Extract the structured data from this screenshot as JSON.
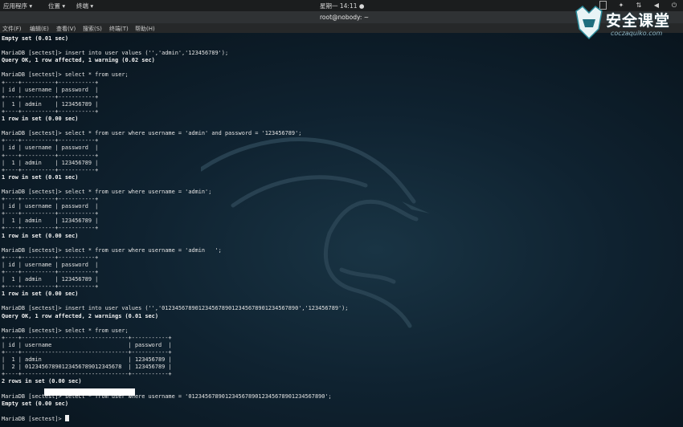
{
  "system_bar": {
    "menus": [
      "应用程序 ▾",
      "位置 ▾",
      "终端 ▾"
    ],
    "clock": "星期一 14:11 ●"
  },
  "window": {
    "title": "root@nobody: ~"
  },
  "terminal_menu": [
    "文件(F)",
    "编辑(E)",
    "查看(V)",
    "搜索(S)",
    "终端(T)",
    "帮助(H)"
  ],
  "watermark": {
    "text": "安全课堂",
    "sub": "coczaquiko.com"
  },
  "terminal_lines": [
    {
      "text": "Empty set (0.01 sec)",
      "bold": true
    },
    {
      "text": "",
      "bold": false
    },
    {
      "text": "MariaDB [sectest]> insert into user values ('','admin','123456789');",
      "bold": false
    },
    {
      "text": "Query OK, 1 row affected, 1 warning (0.02 sec)",
      "bold": true
    },
    {
      "text": "",
      "bold": false
    },
    {
      "text": "MariaDB [sectest]> select * from user;",
      "bold": false
    },
    {
      "text": "+----+----------+-----------+",
      "bold": false
    },
    {
      "text": "| id | username | password  |",
      "bold": false
    },
    {
      "text": "+----+----------+-----------+",
      "bold": false
    },
    {
      "text": "|  1 | admin    | 123456789 |",
      "bold": false
    },
    {
      "text": "+----+----------+-----------+",
      "bold": false
    },
    {
      "text": "1 row in set (0.00 sec)",
      "bold": true
    },
    {
      "text": "",
      "bold": false
    },
    {
      "text": "MariaDB [sectest]> select * from user where username = 'admin' and password = '123456789';",
      "bold": false
    },
    {
      "text": "+----+----------+-----------+",
      "bold": false
    },
    {
      "text": "| id | username | password  |",
      "bold": false
    },
    {
      "text": "+----+----------+-----------+",
      "bold": false
    },
    {
      "text": "|  1 | admin    | 123456789 |",
      "bold": false
    },
    {
      "text": "+----+----------+-----------+",
      "bold": false
    },
    {
      "text": "1 row in set (0.01 sec)",
      "bold": true
    },
    {
      "text": "",
      "bold": false
    },
    {
      "text": "MariaDB [sectest]> select * from user where username = 'admin';",
      "bold": false
    },
    {
      "text": "+----+----------+-----------+",
      "bold": false
    },
    {
      "text": "| id | username | password  |",
      "bold": false
    },
    {
      "text": "+----+----------+-----------+",
      "bold": false
    },
    {
      "text": "|  1 | admin    | 123456789 |",
      "bold": false
    },
    {
      "text": "+----+----------+-----------+",
      "bold": false
    },
    {
      "text": "1 row in set (0.00 sec)",
      "bold": true
    },
    {
      "text": "",
      "bold": false
    },
    {
      "text": "MariaDB [sectest]> select * from user where username = 'admin   ';",
      "bold": false
    },
    {
      "text": "+----+----------+-----------+",
      "bold": false
    },
    {
      "text": "| id | username | password  |",
      "bold": false
    },
    {
      "text": "+----+----------+-----------+",
      "bold": false
    },
    {
      "text": "|  1 | admin    | 123456789 |",
      "bold": false
    },
    {
      "text": "+----+----------+-----------+",
      "bold": false
    },
    {
      "text": "1 row in set (0.00 sec)",
      "bold": true
    },
    {
      "text": "",
      "bold": false
    },
    {
      "text": "MariaDB [sectest]> insert into user values ('','01234567890123456789012345678901234567890','123456789');",
      "bold": false
    },
    {
      "text": "Query OK, 1 row affected, 2 warnings (0.01 sec)",
      "bold": true
    },
    {
      "text": "",
      "bold": false
    },
    {
      "text": "MariaDB [sectest]> select * from user;",
      "bold": false
    },
    {
      "text": "+----+--------------------------------+-----------+",
      "bold": false
    },
    {
      "text": "| id | username                       | password  |",
      "bold": false
    },
    {
      "text": "+----+--------------------------------+-----------+",
      "bold": false
    },
    {
      "text": "|  1 | admin                          | 123456789 |",
      "bold": false
    },
    {
      "text": "|  2 | 01234567890123456789012345678  | 123456789 |",
      "bold": false
    },
    {
      "text": "+----+--------------------------------+-----------+",
      "bold": false
    },
    {
      "text": "2 rows in set (0.00 sec)",
      "bold": true
    },
    {
      "text": "",
      "bold": false
    },
    {
      "text": "MariaDB [sectest]> select * from user where username = '01234567890123456789012345678901234567890';",
      "bold": false
    },
    {
      "text": "Empty set (0.00 sec)",
      "bold": true
    },
    {
      "text": "",
      "bold": false
    }
  ],
  "prompt": "MariaDB [sectest]> ",
  "icons": [
    "dragon-logo",
    "display-icon",
    "accessibility-icon",
    "network-icon",
    "volume-icon",
    "power-icon"
  ]
}
